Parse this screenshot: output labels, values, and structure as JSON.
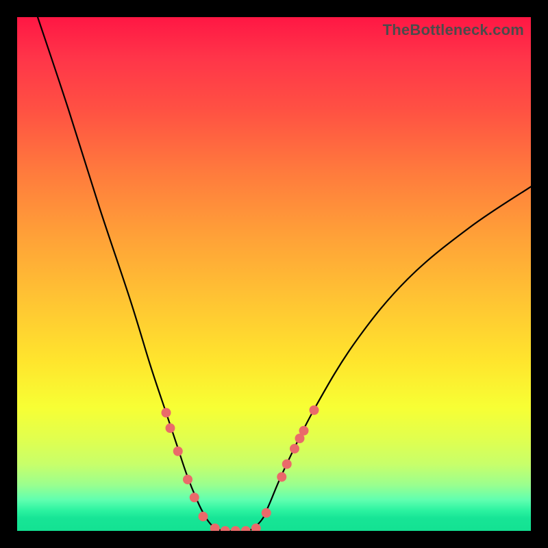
{
  "brand": "TheBottleneck.com",
  "chart_data": {
    "type": "line",
    "title": "",
    "xlabel": "",
    "ylabel": "",
    "xlim": [
      0,
      100
    ],
    "ylim": [
      0,
      100
    ],
    "grid": false,
    "series": [
      {
        "name": "curve",
        "x": [
          4,
          10,
          16,
          22,
          26,
          29,
          31,
          33,
          35,
          36.5,
          38,
          40,
          42,
          45,
          47.5,
          49,
          52,
          58,
          66,
          76,
          88,
          100
        ],
        "y": [
          100,
          82,
          63,
          45,
          32,
          23,
          17,
          11,
          6,
          3,
          1,
          0,
          0,
          0,
          2,
          5,
          12,
          24,
          37,
          49,
          59,
          67
        ]
      }
    ],
    "markers": {
      "color": "#ea6a6a",
      "radius_px": 7,
      "points": [
        {
          "x": 29.0,
          "y": 23.0
        },
        {
          "x": 29.8,
          "y": 20.0
        },
        {
          "x": 31.3,
          "y": 15.5
        },
        {
          "x": 33.2,
          "y": 10.0
        },
        {
          "x": 34.5,
          "y": 6.5
        },
        {
          "x": 36.2,
          "y": 2.8
        },
        {
          "x": 38.5,
          "y": 0.5
        },
        {
          "x": 40.5,
          "y": 0.0
        },
        {
          "x": 42.5,
          "y": 0.0
        },
        {
          "x": 44.5,
          "y": 0.0
        },
        {
          "x": 46.5,
          "y": 0.5
        },
        {
          "x": 48.5,
          "y": 3.5
        },
        {
          "x": 51.5,
          "y": 10.5
        },
        {
          "x": 52.5,
          "y": 13.0
        },
        {
          "x": 54.0,
          "y": 16.0
        },
        {
          "x": 55.0,
          "y": 18.0
        },
        {
          "x": 55.8,
          "y": 19.5
        },
        {
          "x": 57.8,
          "y": 23.5
        }
      ]
    }
  }
}
